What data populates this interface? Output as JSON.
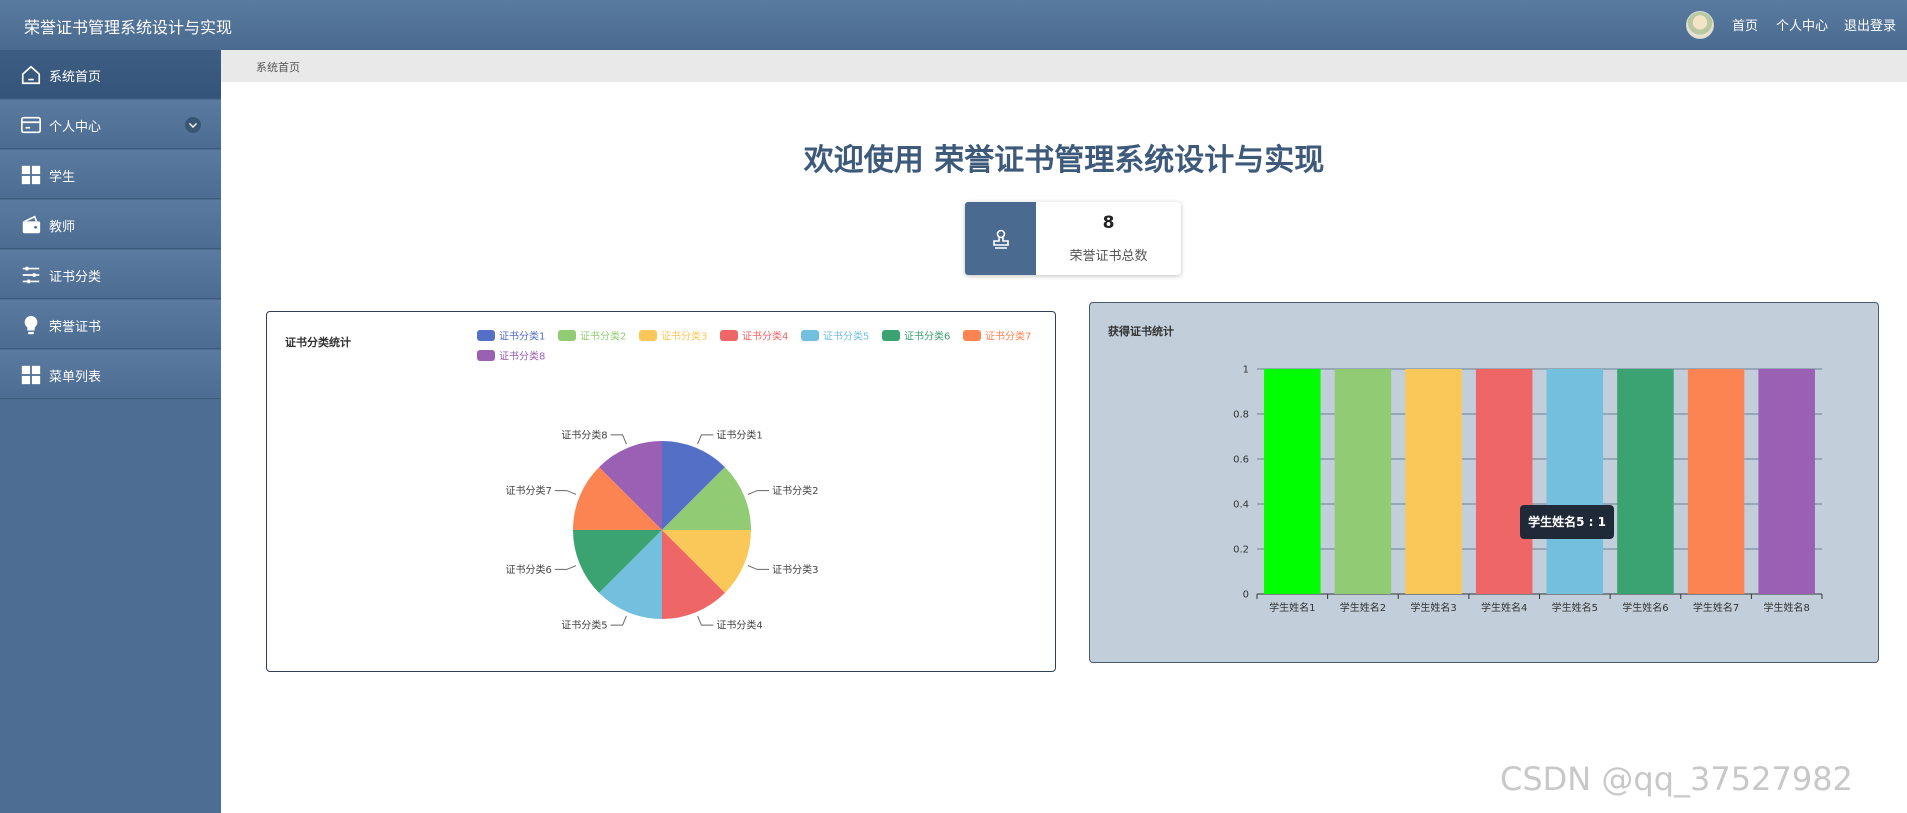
{
  "header": {
    "app_title": "荣誉证书管理系统设计与实现",
    "nav": [
      "首页",
      "个人中心",
      "退出登录"
    ]
  },
  "sidebar": {
    "items": [
      {
        "label": "系统首页",
        "icon": "home-icon",
        "active": true
      },
      {
        "label": "个人中心",
        "icon": "card-icon",
        "has_submenu": true
      },
      {
        "label": "学生",
        "icon": "grid-icon"
      },
      {
        "label": "教师",
        "icon": "wallet-icon"
      },
      {
        "label": "证书分类",
        "icon": "sliders-icon"
      },
      {
        "label": "荣誉证书",
        "icon": "bulb-icon"
      },
      {
        "label": "菜单列表",
        "icon": "grid-icon"
      }
    ]
  },
  "breadcrumb": "系统首页",
  "welcome": "欢迎使用 荣誉证书管理系统设计与实现",
  "stat": {
    "value": "8",
    "label": "荣誉证书总数",
    "icon": "stamp-icon"
  },
  "colors": [
    "#5470c6",
    "#91cc75",
    "#fac858",
    "#ee6666",
    "#73c0de",
    "#3ba272",
    "#fc8452",
    "#9a60b4"
  ],
  "chart_data": [
    {
      "type": "pie",
      "title": "证书分类统计",
      "categories": [
        "证书分类1",
        "证书分类2",
        "证书分类3",
        "证书分类4",
        "证书分类5",
        "证书分类6",
        "证书分类7",
        "证书分类8"
      ],
      "values": [
        1,
        1,
        1,
        1,
        1,
        1,
        1,
        1
      ],
      "legend": "top",
      "colors": [
        "#5470c6",
        "#91cc75",
        "#fac858",
        "#ee6666",
        "#73c0de",
        "#3ba272",
        "#fc8452",
        "#9a60b4"
      ]
    },
    {
      "type": "bar",
      "title": "获得证书统计",
      "categories": [
        "学生姓名1",
        "学生姓名2",
        "学生姓名3",
        "学生姓名4",
        "学生姓名5",
        "学生姓名6",
        "学生姓名7",
        "学生姓名8"
      ],
      "values": [
        1,
        1,
        1,
        1,
        1,
        1,
        1,
        1
      ],
      "ylim": [
        0,
        1
      ],
      "yticks": [
        "0",
        "0.2",
        "0.4",
        "0.6",
        "0.8",
        "1"
      ],
      "grid": true,
      "colors": [
        "#00ff00",
        "#91cc75",
        "#fac858",
        "#ee6666",
        "#73c0de",
        "#3ba272",
        "#fc8452",
        "#9a60b4"
      ],
      "tooltip": "学生姓名5 : 1"
    }
  ],
  "watermark": "CSDN @qq_37527982"
}
